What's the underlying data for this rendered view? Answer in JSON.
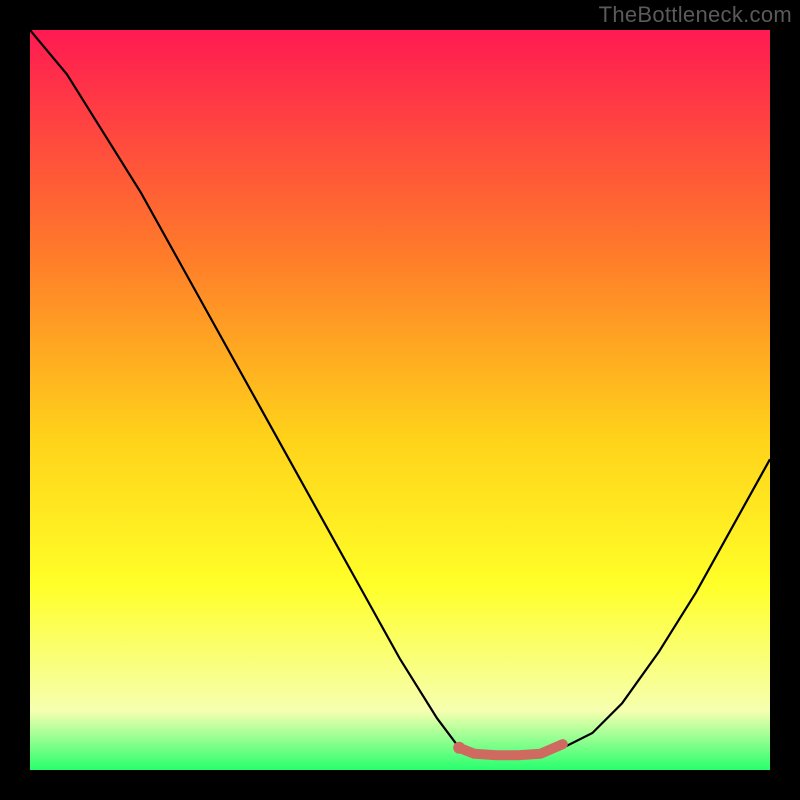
{
  "watermark": "TheBottleneck.com",
  "colors": {
    "gradient_top": "#ff1a52",
    "gradient_mid1": "#ff7a2a",
    "gradient_mid2": "#ffd21a",
    "gradient_mid3": "#ffff28",
    "gradient_mid4": "#f6ffb0",
    "gradient_bottom": "#28ff6e",
    "curve": "#000000",
    "marker": "#cf6a61",
    "frame": "#000000"
  },
  "chart_data": {
    "type": "line",
    "title": "",
    "xlabel": "",
    "ylabel": "",
    "xlim": [
      0,
      1
    ],
    "ylim": [
      0,
      1
    ],
    "series": [
      {
        "name": "bottleneck-curve",
        "x": [
          0.0,
          0.05,
          0.1,
          0.15,
          0.2,
          0.25,
          0.3,
          0.35,
          0.4,
          0.45,
          0.5,
          0.55,
          0.58,
          0.6,
          0.63,
          0.68,
          0.72,
          0.76,
          0.8,
          0.85,
          0.9,
          0.95,
          1.0
        ],
        "values": [
          1.0,
          0.94,
          0.86,
          0.78,
          0.69,
          0.6,
          0.51,
          0.42,
          0.33,
          0.24,
          0.15,
          0.07,
          0.03,
          0.02,
          0.02,
          0.02,
          0.03,
          0.05,
          0.09,
          0.16,
          0.24,
          0.33,
          0.42
        ]
      }
    ],
    "highlight": {
      "name": "optimal-range-marker",
      "x": [
        0.58,
        0.6,
        0.63,
        0.66,
        0.69,
        0.72
      ],
      "values": [
        0.03,
        0.022,
        0.02,
        0.02,
        0.022,
        0.035
      ]
    }
  }
}
